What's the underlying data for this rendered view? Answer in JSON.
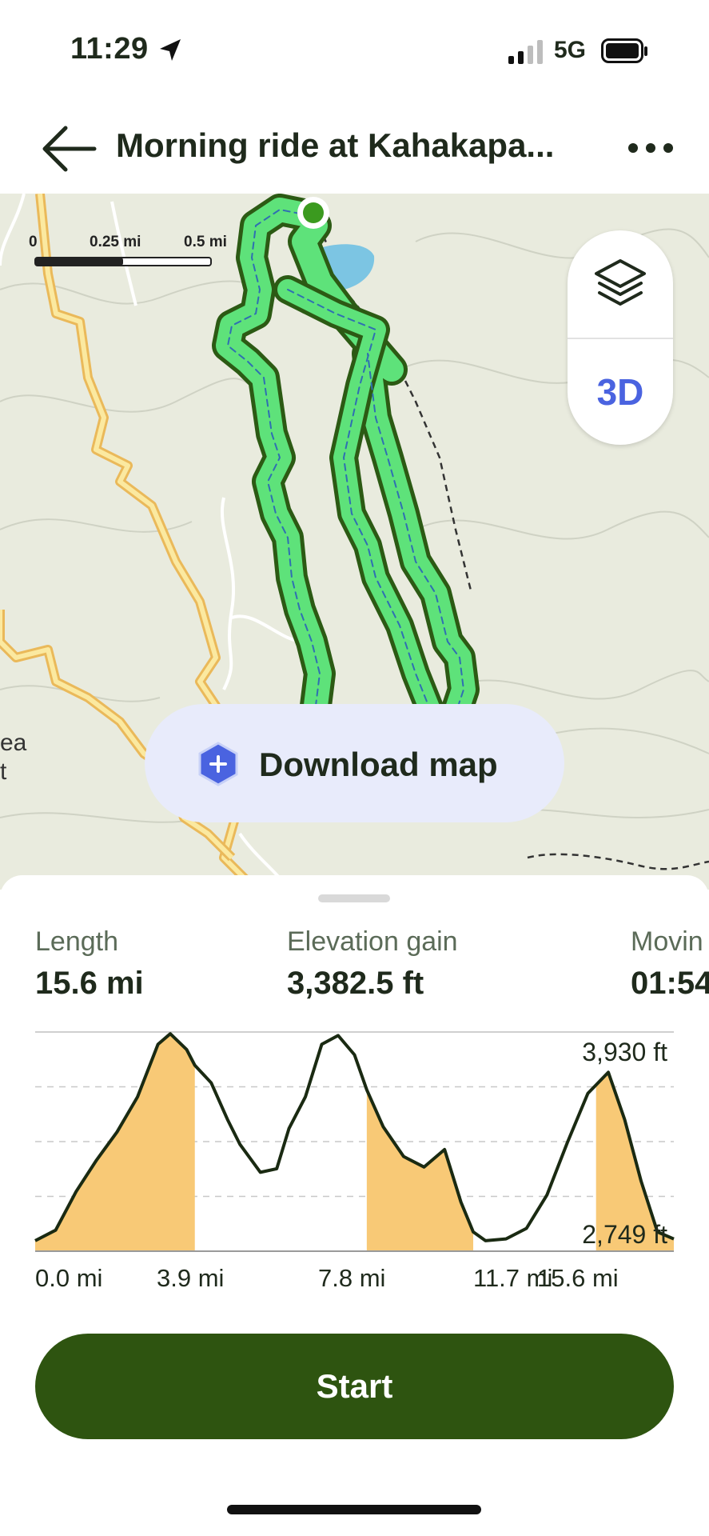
{
  "status_bar": {
    "time": "11:29",
    "network": "5G"
  },
  "header": {
    "title": "Morning ride at Kahakapa..."
  },
  "map": {
    "scale_labels": [
      "0",
      "0.25 mi",
      "0.5 mi"
    ],
    "btn_3d": "3D",
    "edge_label_1": "ea",
    "edge_label_2": "t",
    "download_label": "Download map"
  },
  "stats": [
    {
      "label": "Length",
      "value": "15.6 mi"
    },
    {
      "label": "Elevation gain",
      "value": "3,382.5 ft"
    },
    {
      "label": "Movin",
      "value": "01:54"
    }
  ],
  "chart_data": {
    "type": "area",
    "max_label": "3,930 ft",
    "min_label": "2,749 ft",
    "x_tick_labels": [
      "0.0 mi",
      "3.9 mi",
      "7.8 mi",
      "11.7 mi",
      "15.6 mi"
    ],
    "x": [
      0,
      0.5,
      1,
      1.5,
      2,
      2.5,
      3,
      3.3,
      3.7,
      3.9,
      4.3,
      4.7,
      5,
      5.5,
      5.9,
      6.2,
      6.6,
      7,
      7.4,
      7.8,
      8.1,
      8.5,
      9,
      9.5,
      10,
      10.4,
      10.7,
      11,
      11.5,
      12,
      12.5,
      13,
      13.5,
      14,
      14.4,
      14.8,
      15.2,
      15.6
    ],
    "y": [
      2760,
      2820,
      3040,
      3220,
      3380,
      3580,
      3880,
      3940,
      3850,
      3760,
      3660,
      3450,
      3310,
      3150,
      3170,
      3400,
      3580,
      3880,
      3930,
      3820,
      3620,
      3410,
      3240,
      3180,
      3280,
      2980,
      2810,
      2760,
      2770,
      2830,
      3020,
      3320,
      3600,
      3720,
      3450,
      3100,
      2810,
      2770
    ],
    "ylim": [
      2700,
      3950
    ],
    "shaded_ranges_mi": [
      [
        0,
        3.9
      ],
      [
        8.1,
        10.7
      ],
      [
        13.7,
        16.7
      ]
    ],
    "colors": {
      "line": "#1a2a12",
      "fill": "#f8c976",
      "grid": "#c8c8c8"
    }
  },
  "start_button": {
    "label": "Start"
  },
  "colors": {
    "accent": "#2e5410",
    "route": "#5ee27a",
    "three_d": "#4a63e0"
  }
}
